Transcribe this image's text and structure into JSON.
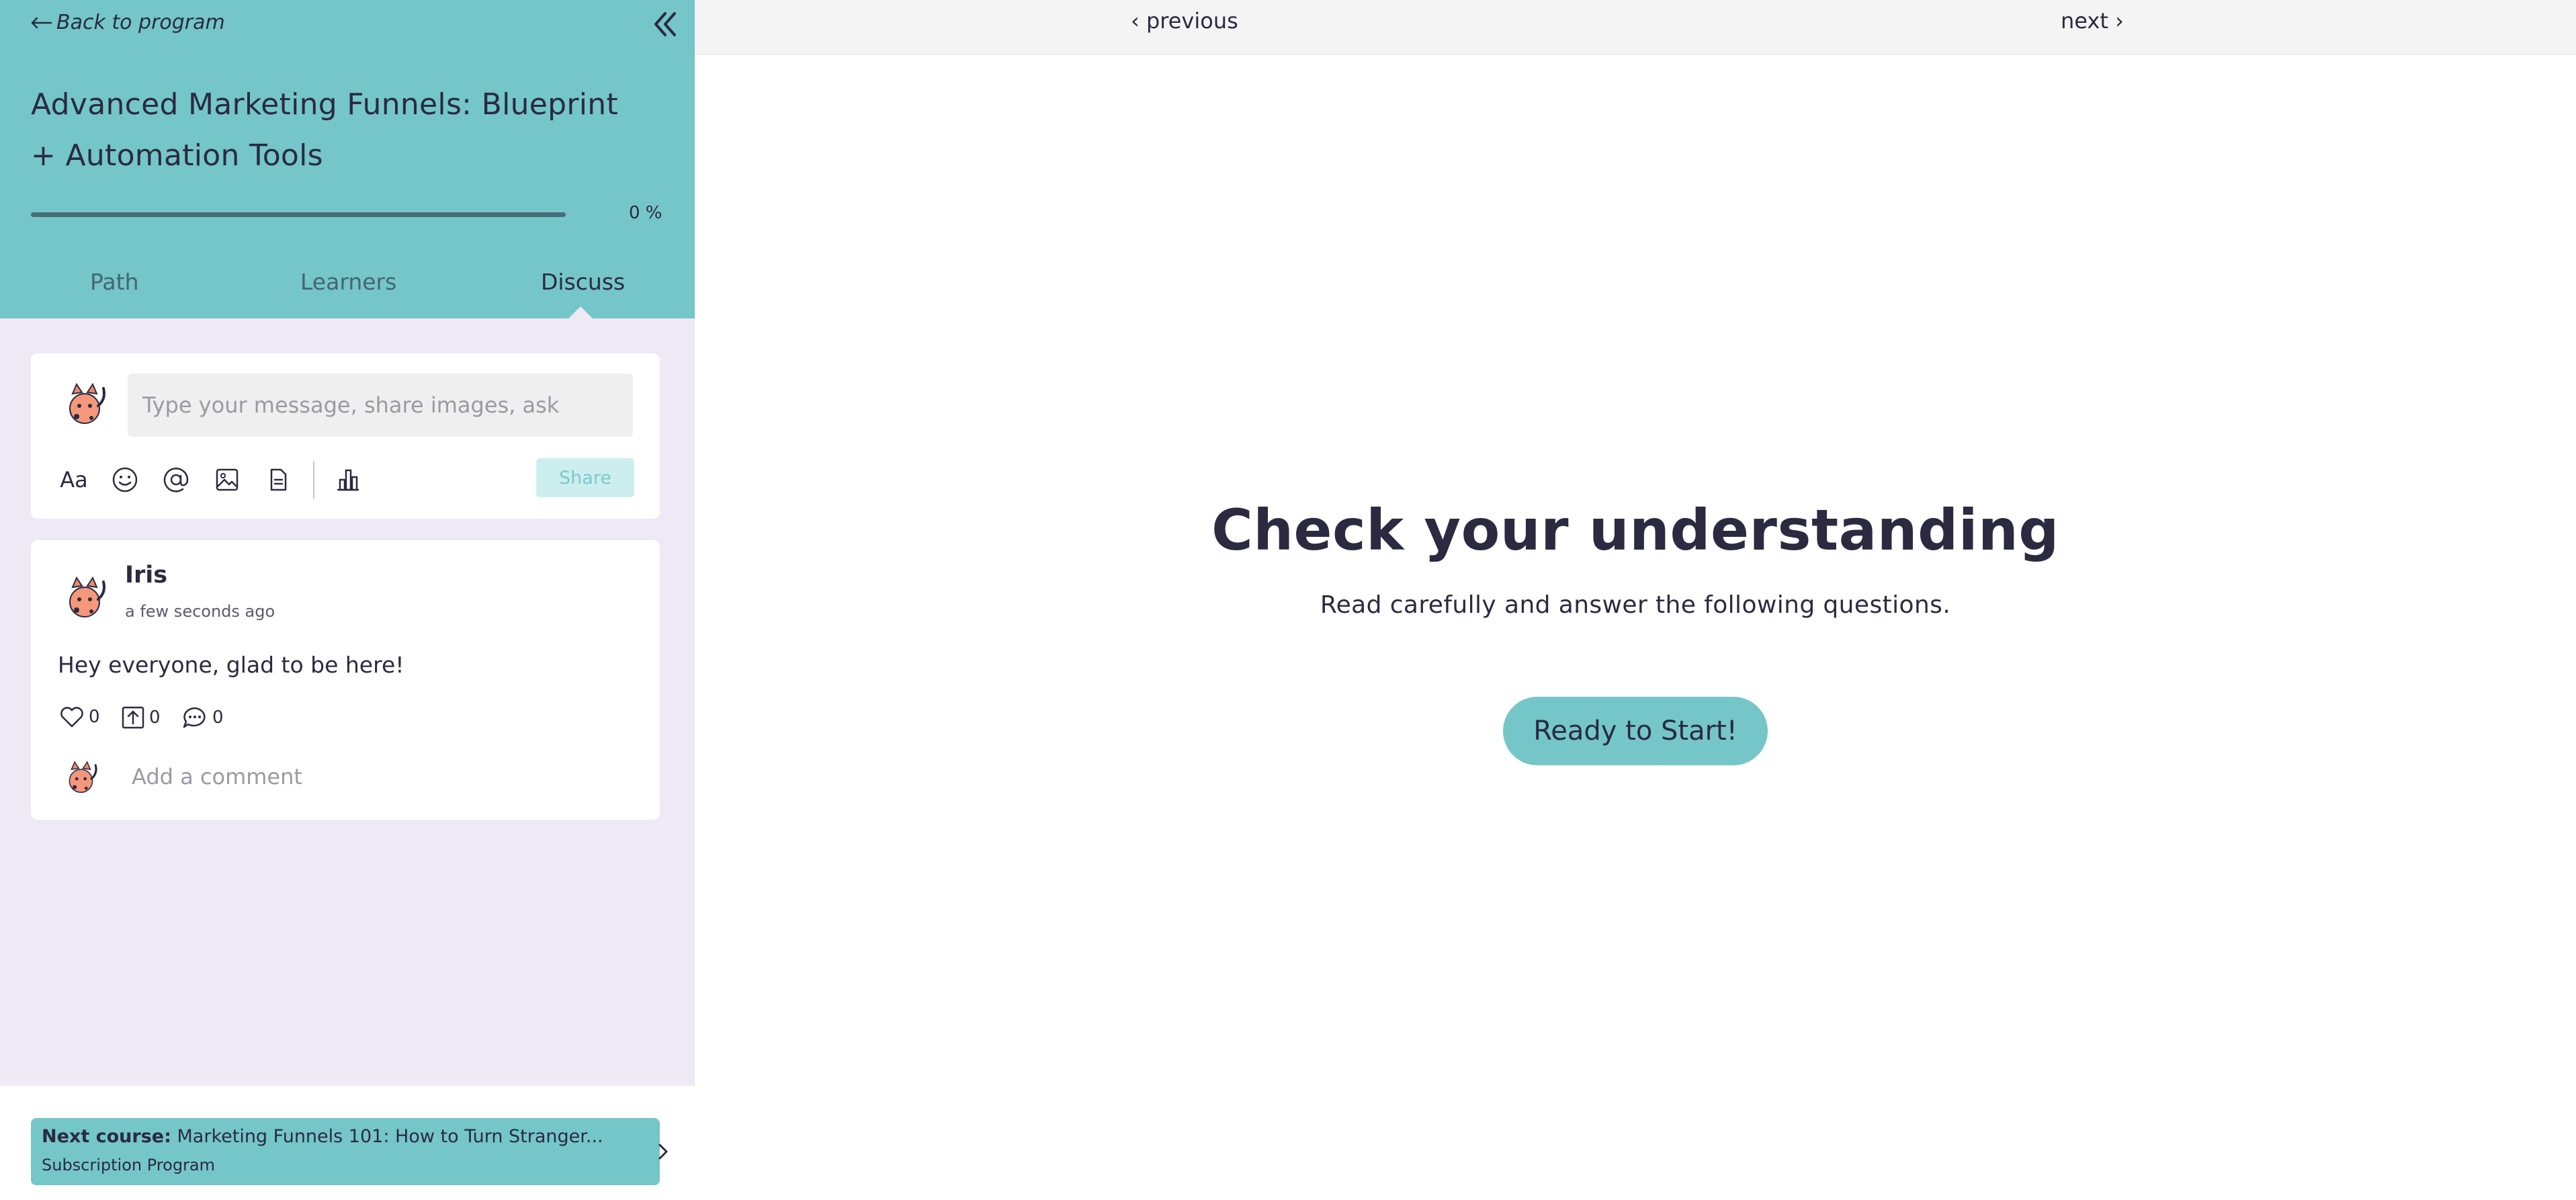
{
  "sidebar": {
    "back_link": "Back to program",
    "course_title": "Advanced Marketing Funnels: Blueprint + Automation Tools",
    "progress": {
      "value": 0,
      "label": "0 %"
    },
    "tabs": [
      {
        "label": "Path",
        "active": false
      },
      {
        "label": "Learners",
        "active": false
      },
      {
        "label": "Discuss",
        "active": true
      }
    ],
    "composer": {
      "placeholder": "Type your message, share images, ask",
      "format_label": "Aa",
      "tools": [
        "text-format-icon",
        "emoji-icon",
        "mention-icon",
        "image-icon",
        "document-icon",
        "poll-chart-icon"
      ],
      "share_label": "Share"
    },
    "post": {
      "author": "Iris",
      "time": "a few seconds ago",
      "body": "Hey everyone, glad to be here!",
      "likes": "0",
      "shares": "0",
      "comments": "0",
      "comment_placeholder": "Add a comment"
    },
    "next_course": {
      "label": "Next course:",
      "title": "Marketing Funnels 101: How to Turn Stranger...",
      "subtitle": "Subscription Program"
    }
  },
  "main": {
    "previous_label": "‹ previous",
    "next_label": "next ›",
    "heading": "Check your understanding",
    "subheading": "Read carefully and answer the following questions.",
    "start_button": "Ready to Start!"
  },
  "colors": {
    "accent_teal": "#74c6c9",
    "sidebar_bg": "#efe9f6",
    "text_dark": "#2b2a40",
    "share_disabled_bg": "#cdeeee"
  }
}
